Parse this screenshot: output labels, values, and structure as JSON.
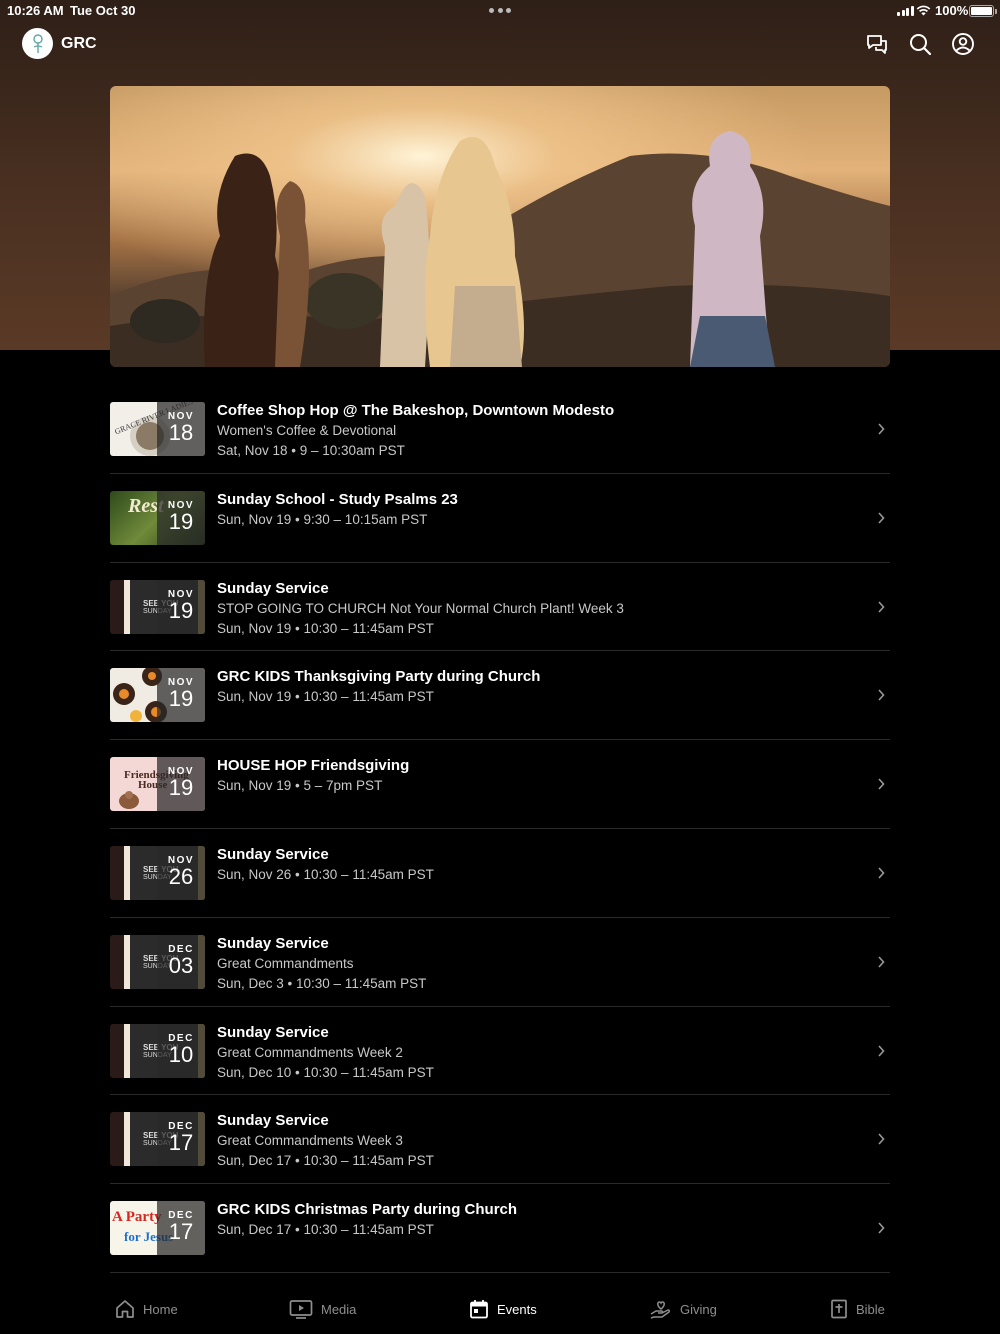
{
  "status_bar": {
    "time": "10:26 AM",
    "date": "Tue Oct 30",
    "battery": "100%"
  },
  "header": {
    "title": "GRC"
  },
  "hero": {
    "image": "photo-people-at-sunset"
  },
  "events": [
    {
      "title": "Coffee Shop Hop @ The Bakeshop, Downtown Modesto",
      "subtitle": "Women's Coffee & Devotional",
      "when": "Sat, Nov 18 • 9 – 10:30am PST",
      "month": "NOV",
      "day": "18",
      "thumb": "grace-river-ladies-logo"
    },
    {
      "title": "Sunday School - Study Psalms 23",
      "subtitle": "",
      "when": "Sun, Nov 19 • 9:30 – 10:15am PST",
      "month": "NOV",
      "day": "19",
      "thumb": "rest-study-graphic"
    },
    {
      "title": "Sunday Service",
      "subtitle": "STOP GOING TO CHURCH Not Your Normal Church Plant! Week 3",
      "when": "Sun, Nov 19 • 10:30 – 11:45am PST",
      "month": "NOV",
      "day": "19",
      "thumb": "see-you-sunday"
    },
    {
      "title": "GRC KIDS Thanksgiving Party  during Church",
      "subtitle": "",
      "when": "Sun, Nov 19 • 10:30 – 11:45am PST",
      "month": "NOV",
      "day": "19",
      "thumb": "turkey-cupcakes"
    },
    {
      "title": "HOUSE HOP Friendsgiving",
      "subtitle": "",
      "when": "Sun, Nov 19 • 5 – 7pm PST",
      "month": "NOV",
      "day": "19",
      "thumb": "friendsgiving-flyer"
    },
    {
      "title": "Sunday Service",
      "subtitle": "",
      "when": "Sun, Nov 26 • 10:30 – 11:45am PST",
      "month": "NOV",
      "day": "26",
      "thumb": "see-you-sunday"
    },
    {
      "title": "Sunday Service",
      "subtitle": "Great Commandments",
      "when": "Sun, Dec 3 • 10:30 – 11:45am PST",
      "month": "DEC",
      "day": "03",
      "thumb": "see-you-sunday"
    },
    {
      "title": "Sunday Service",
      "subtitle": "Great Commandments Week 2",
      "when": "Sun, Dec 10 • 10:30 – 11:45am PST",
      "month": "DEC",
      "day": "10",
      "thumb": "see-you-sunday"
    },
    {
      "title": "Sunday Service",
      "subtitle": "Great Commandments Week 3",
      "when": "Sun, Dec 17 • 10:30 – 11:45am PST",
      "month": "DEC",
      "day": "17",
      "thumb": "see-you-sunday"
    },
    {
      "title": "GRC KIDS Christmas Party during Church",
      "subtitle": "",
      "when": "Sun, Dec 17 • 10:30 – 11:45am PST",
      "month": "DEC",
      "day": "17",
      "thumb": "party-for-jesus"
    }
  ],
  "thumb_text": {
    "see_you": "SEE YOU",
    "sunday": "SUNDAY",
    "grace": "GRACE RIVER LADIES",
    "friendsgiving": "Friendsgiving",
    "house": "House",
    "rest": "Rest",
    "party": "A Party",
    "for_jesus": "for Jesus"
  },
  "tabs": [
    {
      "label": "Home",
      "icon": "home-icon"
    },
    {
      "label": "Media",
      "icon": "media-icon"
    },
    {
      "label": "Events",
      "icon": "calendar-icon",
      "active": true
    },
    {
      "label": "Giving",
      "icon": "giving-icon"
    },
    {
      "label": "Bible",
      "icon": "bible-icon"
    }
  ],
  "colors": {
    "background": "#000000",
    "header_brown": "#4a3021",
    "text_secondary": "#c8c8c8",
    "tab_inactive": "#8e8e8e"
  }
}
